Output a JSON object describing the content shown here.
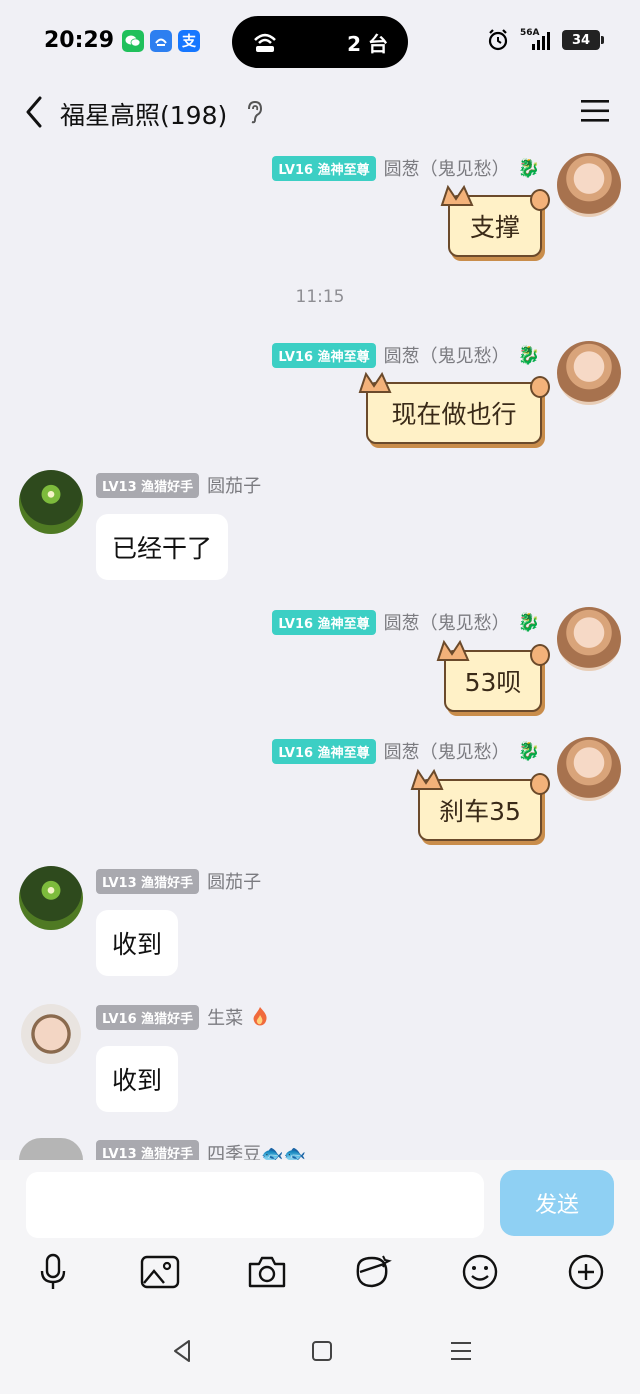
{
  "status": {
    "time": "20:29",
    "island_count": "2 台",
    "signal": "56A",
    "battery": "34"
  },
  "header": {
    "title": "福星高照(198)"
  },
  "timestamp": "11:15",
  "messages": [
    {
      "badge": "LV16 渔神至尊",
      "name": "圆葱（鬼见愁）",
      "text": "支撑"
    },
    {
      "badge": "LV16 渔神至尊",
      "name": "圆葱（鬼见愁）",
      "text": "现在做也行"
    },
    {
      "badge": "LV13 渔猎好手",
      "name": "圆茄子",
      "text": "已经干了"
    },
    {
      "badge": "LV16 渔神至尊",
      "name": "圆葱（鬼见愁）",
      "text": "53呗"
    },
    {
      "badge": "LV16 渔神至尊",
      "name": "圆葱（鬼见愁）",
      "text": "刹车35"
    },
    {
      "badge": "LV13 渔猎好手",
      "name": "圆茄子",
      "text": "收到"
    },
    {
      "badge": "LV16 渔猎好手",
      "name": "生菜",
      "text": "收到"
    },
    {
      "badge": "LV13 渔猎好手",
      "name": "四季豆🐟🐟",
      "text": ""
    }
  ],
  "input": {
    "placeholder": "",
    "send_label": "发送"
  },
  "colors": {
    "teal_badge": "#3ccfc4",
    "gray_badge": "#a9a9af",
    "send_button": "#8fd0f3",
    "cat_bubble": "#fff1c7"
  }
}
